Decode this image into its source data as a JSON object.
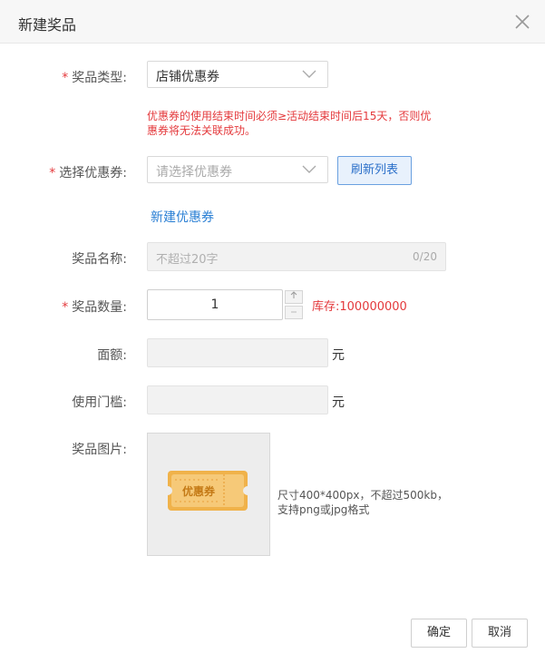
{
  "dialog": {
    "title": "新建奖品"
  },
  "form": {
    "prize_type": {
      "label": "奖品类型:",
      "value": "店铺优惠券"
    },
    "coupon_hint": "优惠券的使用结束时间必须≥活动结束时间后15天，否则优惠券将无法关联成功。",
    "coupon_select": {
      "label": "选择优惠券:",
      "placeholder": "请选择优惠券",
      "refresh_label": "刷新列表"
    },
    "new_coupon_link": "新建优惠券",
    "prize_name": {
      "label": "奖品名称:",
      "placeholder": "不超过20字",
      "counter": "0/20"
    },
    "quantity": {
      "label": "奖品数量:",
      "value": "1",
      "stock": "库存:100000000"
    },
    "face_value": {
      "label": "面额:",
      "unit": "元"
    },
    "threshold": {
      "label": "使用门槛:",
      "unit": "元"
    },
    "prize_image": {
      "label": "奖品图片:",
      "coupon_text": "优惠券",
      "hint": "尺寸400*400px，不超过500kb，支持png或jpg格式"
    }
  },
  "footer": {
    "confirm_label": "确定",
    "cancel_label": "取消"
  },
  "colors": {
    "required": "#e4393c",
    "link": "#2a7fd4",
    "coupon_orange": "#f0b24a"
  }
}
